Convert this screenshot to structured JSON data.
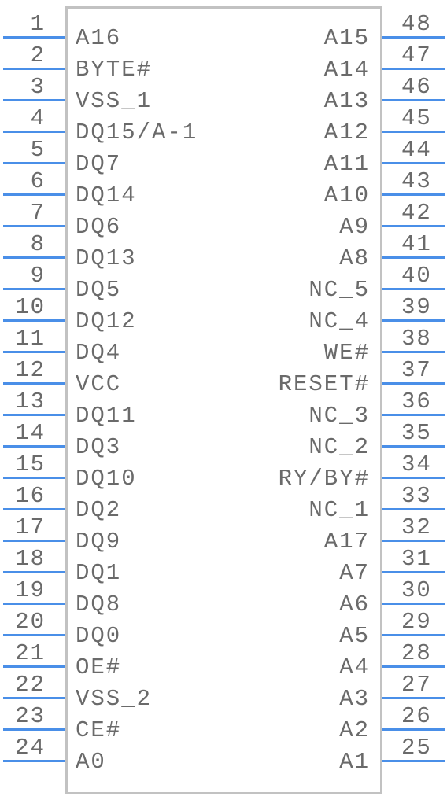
{
  "component": "48-pin IC symbol",
  "line_color": "#4a8fe8",
  "box_color": "#c2c2c2",
  "text_color": "#6a6a6a",
  "left_pins": [
    {
      "num": "1",
      "name": "A16"
    },
    {
      "num": "2",
      "name": "BYTE#"
    },
    {
      "num": "3",
      "name": "VSS_1"
    },
    {
      "num": "4",
      "name": "DQ15/A-1"
    },
    {
      "num": "5",
      "name": "DQ7"
    },
    {
      "num": "6",
      "name": "DQ14"
    },
    {
      "num": "7",
      "name": "DQ6"
    },
    {
      "num": "8",
      "name": "DQ13"
    },
    {
      "num": "9",
      "name": "DQ5"
    },
    {
      "num": "10",
      "name": "DQ12"
    },
    {
      "num": "11",
      "name": "DQ4"
    },
    {
      "num": "12",
      "name": "VCC"
    },
    {
      "num": "13",
      "name": "DQ11"
    },
    {
      "num": "14",
      "name": "DQ3"
    },
    {
      "num": "15",
      "name": "DQ10"
    },
    {
      "num": "16",
      "name": "DQ2"
    },
    {
      "num": "17",
      "name": "DQ9"
    },
    {
      "num": "18",
      "name": "DQ1"
    },
    {
      "num": "19",
      "name": "DQ8"
    },
    {
      "num": "20",
      "name": "DQ0"
    },
    {
      "num": "21",
      "name": "OE#"
    },
    {
      "num": "22",
      "name": "VSS_2"
    },
    {
      "num": "23",
      "name": "CE#"
    },
    {
      "num": "24",
      "name": "A0"
    }
  ],
  "right_pins": [
    {
      "num": "48",
      "name": "A15"
    },
    {
      "num": "47",
      "name": "A14"
    },
    {
      "num": "46",
      "name": "A13"
    },
    {
      "num": "45",
      "name": "A12"
    },
    {
      "num": "44",
      "name": "A11"
    },
    {
      "num": "43",
      "name": "A10"
    },
    {
      "num": "42",
      "name": "A9"
    },
    {
      "num": "41",
      "name": "A8"
    },
    {
      "num": "40",
      "name": "NC_5"
    },
    {
      "num": "39",
      "name": "NC_4"
    },
    {
      "num": "38",
      "name": "WE#"
    },
    {
      "num": "37",
      "name": "RESET#"
    },
    {
      "num": "36",
      "name": "NC_3"
    },
    {
      "num": "35",
      "name": "NC_2"
    },
    {
      "num": "34",
      "name": "RY/BY#"
    },
    {
      "num": "33",
      "name": "NC_1"
    },
    {
      "num": "32",
      "name": "A17"
    },
    {
      "num": "31",
      "name": "A7"
    },
    {
      "num": "30",
      "name": "A6"
    },
    {
      "num": "29",
      "name": "A5"
    },
    {
      "num": "28",
      "name": "A4"
    },
    {
      "num": "27",
      "name": "A3"
    },
    {
      "num": "26",
      "name": "A2"
    },
    {
      "num": "25",
      "name": "A1"
    }
  ]
}
